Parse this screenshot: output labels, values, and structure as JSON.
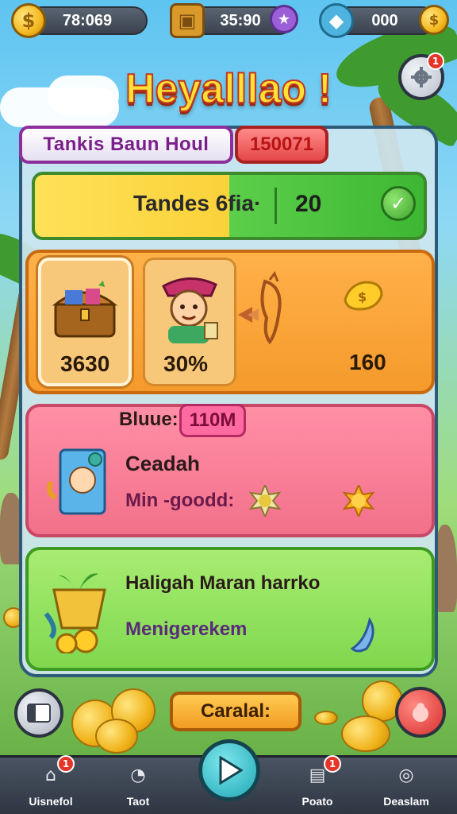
{
  "resources": {
    "coins": "78:069",
    "crates": "35:90",
    "gems": "000"
  },
  "title": "Heyalllao !",
  "panel": {
    "title": "Tankis Baun Houl",
    "badge": "150071"
  },
  "progress": {
    "label": "Tandes 6fia·",
    "value": "20",
    "fill_fraction": 0.5
  },
  "rewards": [
    {
      "value": "3630",
      "art": "treasure-chest"
    },
    {
      "value": "30%",
      "art": "character"
    },
    {
      "value": "",
      "art": "arrow-creature"
    },
    {
      "value": "160",
      "art": "gold-nugget"
    }
  ],
  "pink_card": {
    "label": "Bluue:",
    "badge": "110M",
    "line1": "Ceadah",
    "line2": "Min -goodd:"
  },
  "green_card": {
    "line1": "Haligah Maran harrko",
    "line2": "Menigerekem"
  },
  "cancel_button": "Caralal:",
  "notifications": {
    "top_right": "1",
    "nav_home": "1",
    "nav_news": "1"
  },
  "nav": [
    {
      "label": "Uisnefol",
      "icon": "home-icon"
    },
    {
      "label": "Taot",
      "icon": "timer-icon"
    },
    {
      "label": "",
      "icon": "play-icon"
    },
    {
      "label": "Poato",
      "icon": "news-icon"
    },
    {
      "label": "Deaslam",
      "icon": "magnifier-icon"
    }
  ],
  "colors": {
    "title_fill": "#ffe135",
    "title_outline": "#c2381f",
    "panel_border": "#2e5a7a",
    "rewards_card": "#f59a2b",
    "pink_card": "#f2708a",
    "green_card": "#7fd84e"
  }
}
